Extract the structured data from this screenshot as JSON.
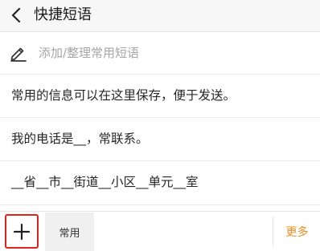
{
  "header": {
    "title": "快捷短语",
    "back_icon": "chevron-left-icon"
  },
  "edit_row": {
    "icon": "pencil-icon",
    "label": "添加/整理常用短语"
  },
  "phrases": [
    "常用的信息可以在这里保存，便于发送。",
    "我的电话是__，常联系。",
    "__省__市__街道__小区__单元__室"
  ],
  "footer": {
    "add_icon": "plus-icon",
    "tab_label": "常用",
    "more_label": "更多"
  },
  "colors": {
    "highlight_border": "#e0241b",
    "more_text": "#f08c1c",
    "header_bg": "#f7f7f7",
    "tab_bg": "#f0f0f0"
  }
}
